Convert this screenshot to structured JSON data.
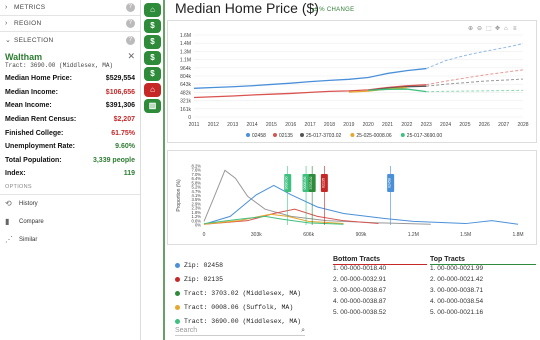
{
  "sidebar": {
    "metrics_label": "METRICS",
    "region_label": "REGION",
    "selection_label": "SELECTION",
    "selection_name": "Waltham",
    "selection_tract": "Tract: 3690.00 (Middlesex, MA)",
    "stats": [
      {
        "key": "Median Home Price:",
        "value": "$529,554",
        "tone": "dark"
      },
      {
        "key": "Median Income:",
        "value": "$106,656",
        "tone": "red"
      },
      {
        "key": "Mean Income:",
        "value": "$391,306",
        "tone": "dark"
      },
      {
        "key": "Median Rent Census:",
        "value": "$2,207",
        "tone": "red"
      },
      {
        "key": "Finished College:",
        "value": "61.75%",
        "tone": "red"
      },
      {
        "key": "Unemployment Rate:",
        "value": "9.60%",
        "tone": "green"
      },
      {
        "key": "Total Population:",
        "value": "3,339 people",
        "tone": "green"
      },
      {
        "key": "Index:",
        "value": "119",
        "tone": "green"
      }
    ],
    "options_label": "OPTIONS",
    "options": [
      {
        "label": "History",
        "icon": "history-icon"
      },
      {
        "label": "Compare",
        "icon": "bar-chart-icon"
      },
      {
        "label": "Similar",
        "icon": "scatter-icon"
      }
    ]
  },
  "rail": {
    "buttons": [
      {
        "icon": "home-icon",
        "glyph": "⌂",
        "color": "#2e8b3a"
      },
      {
        "icon": "dollar-icon",
        "glyph": "$",
        "color": "#2e8b3a"
      },
      {
        "icon": "dollar-icon",
        "glyph": "$",
        "color": "#2e8b3a"
      },
      {
        "icon": "dollar-icon",
        "glyph": "$",
        "color": "#2e8b3a"
      },
      {
        "icon": "dollar-icon",
        "glyph": "$",
        "color": "#2e8b3a"
      },
      {
        "icon": "bank-icon",
        "glyph": "⌂",
        "color": "#c62828"
      },
      {
        "icon": "building-icon",
        "glyph": "▥",
        "color": "#2e8b3a"
      }
    ]
  },
  "main": {
    "title": "Median Home Price ($)",
    "pct_change_label": "% CHANGE"
  },
  "chart_data": [
    {
      "type": "line",
      "title": "",
      "x": [
        2011,
        2012,
        2013,
        2014,
        2015,
        2016,
        2017,
        2018,
        2019,
        2020,
        2021,
        2022,
        2023,
        2024,
        2025,
        2026,
        2027,
        2028
      ],
      "yticks": [
        "0",
        "161k",
        "321k",
        "482k",
        "643k",
        "804k",
        "964k",
        "1.1M",
        "1.3M",
        "1.4M",
        "1.6M"
      ],
      "ylim": [
        0,
        1600000
      ],
      "series": [
        {
          "name": "02458",
          "color": "#4a90d9",
          "values": [
            560000,
            575000,
            590000,
            610000,
            635000,
            660000,
            690000,
            715000,
            735000,
            770000,
            850000,
            905000,
            945000,
            null,
            null,
            null,
            null,
            null
          ],
          "forecast": [
            945000,
            1100000,
            1200000,
            1280000,
            1350000,
            1430000
          ]
        },
        {
          "name": "02135",
          "color": "#d9534f",
          "values": [
            380000,
            395000,
            410000,
            430000,
            445000,
            460000,
            480000,
            500000,
            510000,
            530000,
            575000,
            610000,
            630000,
            null,
            null,
            null,
            null,
            null
          ],
          "forecast": [
            630000,
            700000,
            760000,
            820000,
            870000,
            920000
          ]
        },
        {
          "name": "25-017-3703.02",
          "color": "#555555",
          "values": [
            null,
            null,
            null,
            null,
            null,
            null,
            null,
            null,
            null,
            520000,
            560000,
            590000,
            600000,
            null,
            null,
            null,
            null,
            null
          ],
          "forecast": [
            600000,
            640000,
            670000,
            700000,
            720000,
            740000
          ]
        },
        {
          "name": "25-025-0008.06",
          "color": "#e6a82e",
          "values": [
            null,
            null,
            null,
            null,
            null,
            null,
            null,
            null,
            485000,
            505000,
            545000,
            575000,
            null,
            null,
            null,
            null,
            null,
            null
          ]
        },
        {
          "name": "25-017-3690.00",
          "color": "#3fc07f",
          "values": [
            null,
            null,
            null,
            null,
            null,
            null,
            null,
            null,
            null,
            520000,
            540000,
            545000,
            495000,
            null,
            null,
            null,
            null,
            null
          ],
          "forecast": [
            495000,
            500000,
            505000,
            510000,
            515000,
            520000
          ]
        }
      ],
      "legend": [
        "02458",
        "02135",
        "25-017-3703.02",
        "25-025-0008.06",
        "25-017-3690.00"
      ]
    },
    {
      "type": "area",
      "ylabel": "Proportion (%)",
      "yticks": [
        "0%",
        "0.6%",
        "1.2%",
        "1.8%",
        "2.3%",
        "2.9%",
        "3.5%",
        "4.1%",
        "4.7%",
        "5.2%",
        "5.8%",
        "6.4%",
        "7.0%",
        "7.6%",
        "8.2%"
      ],
      "xticks": [
        "0",
        "303k",
        "606k",
        "909k",
        "1.2M",
        "1.5M",
        "1.8M"
      ],
      "xlim": [
        0,
        1800000
      ],
      "ylim": [
        0,
        8.2
      ],
      "markers": [
        {
          "label": "3690.00",
          "x": 480000,
          "color": "#3fc07f"
        },
        {
          "label": "0008.06",
          "x": 585000,
          "color": "#3fc07f"
        },
        {
          "label": "3703.02",
          "x": 620000,
          "color": "#2e8b3a"
        },
        {
          "label": "02135",
          "x": 690000,
          "color": "#c62828"
        },
        {
          "label": "02458",
          "x": 1070000,
          "color": "#4a90d9"
        }
      ]
    }
  ],
  "zips": [
    {
      "label": "Zip: 02458",
      "color": "#4a90d9"
    },
    {
      "label": "Zip: 02135",
      "color": "#c62828"
    },
    {
      "label": "Tract: 3703.02 (Middlesex, MA)",
      "color": "#2e8b3a"
    },
    {
      "label": "Tract: 0008.06 (Suffolk, MA)",
      "color": "#e6a82e"
    },
    {
      "label": "Tract: 3690.00 (Middlesex, MA)",
      "color": "#3fc07f"
    }
  ],
  "search_placeholder": "Search",
  "bottom_tracts": {
    "title": "Bottom Tracts",
    "rows": [
      "1. 00-000-0018.40",
      "2. 00-000-0032.91",
      "3. 00-000-0038.67",
      "4. 00-000-0038.87",
      "5. 00-000-0038.52"
    ]
  },
  "top_tracts": {
    "title": "Top Tracts",
    "rows": [
      "1. 00-000-0021.99",
      "2. 00-000-0021.42",
      "3. 00-000-0038.71",
      "4. 00-000-0038.54",
      "5. 00-000-0021.16"
    ]
  }
}
